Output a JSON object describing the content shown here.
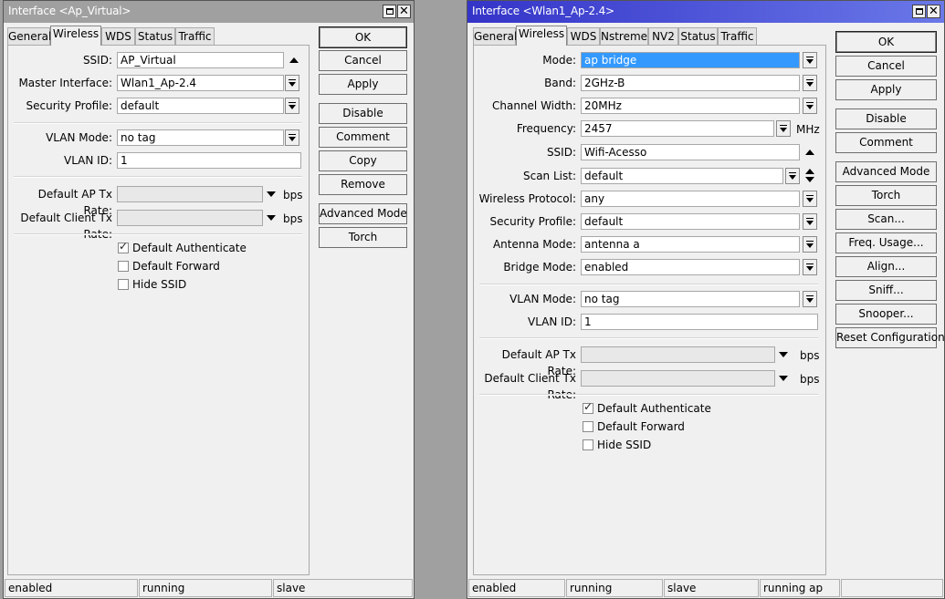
{
  "left": {
    "title": "Interface <Ap_Virtual>",
    "titlebar_color": "#a0a0a0",
    "tabs": [
      "General",
      "Wireless",
      "WDS",
      "Status",
      "Traffic"
    ],
    "active_tab": "Wireless",
    "ssid": {
      "label": "SSID:",
      "value": "AP_Virtual"
    },
    "master_interface": {
      "label": "Master Interface:",
      "value": "Wlan1_Ap-2.4"
    },
    "security_profile": {
      "label": "Security Profile:",
      "value": "default"
    },
    "vlan_mode": {
      "label": "VLAN Mode:",
      "value": "no tag"
    },
    "vlan_id": {
      "label": "VLAN ID:",
      "value": "1"
    },
    "default_ap_tx_rate": {
      "label": "Default AP Tx Rate:",
      "value": "",
      "unit": "bps"
    },
    "default_client_tx_rate": {
      "label": "Default Client Tx Rate:",
      "value": "",
      "unit": "bps"
    },
    "checkboxes": [
      {
        "label": "Default Authenticate",
        "checked": true
      },
      {
        "label": "Default Forward",
        "checked": false
      },
      {
        "label": "Hide SSID",
        "checked": false
      }
    ],
    "buttons": [
      "OK",
      "Cancel",
      "Apply",
      "Disable",
      "Comment",
      "Copy",
      "Remove",
      "Advanced Mode",
      "Torch"
    ],
    "status": [
      "enabled",
      "running",
      "slave"
    ]
  },
  "right": {
    "title": "Interface <Wlan1_Ap-2.4>",
    "titlebar_color": "#3c46d8",
    "tabs": [
      "General",
      "Wireless",
      "WDS",
      "Nstreme",
      "NV2",
      "Status",
      "Traffic"
    ],
    "active_tab": "Wireless",
    "mode": {
      "label": "Mode:",
      "value": "ap bridge"
    },
    "band": {
      "label": "Band:",
      "value": "2GHz-B"
    },
    "channel_width": {
      "label": "Channel Width:",
      "value": "20MHz"
    },
    "frequency": {
      "label": "Frequency:",
      "value": "2457",
      "unit": "MHz"
    },
    "ssid": {
      "label": "SSID:",
      "value": "Wifi-Acesso"
    },
    "scan_list": {
      "label": "Scan List:",
      "value": "default"
    },
    "wireless_protocol": {
      "label": "Wireless Protocol:",
      "value": "any"
    },
    "security_profile": {
      "label": "Security Profile:",
      "value": "default"
    },
    "antenna_mode": {
      "label": "Antenna Mode:",
      "value": "antenna a"
    },
    "bridge_mode": {
      "label": "Bridge Mode:",
      "value": "enabled"
    },
    "vlan_mode": {
      "label": "VLAN Mode:",
      "value": "no tag"
    },
    "vlan_id": {
      "label": "VLAN ID:",
      "value": "1"
    },
    "default_ap_tx_rate": {
      "label": "Default AP Tx Rate:",
      "value": "",
      "unit": "bps"
    },
    "default_client_tx_rate": {
      "label": "Default Client Tx Rate:",
      "value": "",
      "unit": "bps"
    },
    "checkboxes": [
      {
        "label": "Default Authenticate",
        "checked": true
      },
      {
        "label": "Default Forward",
        "checked": false
      },
      {
        "label": "Hide SSID",
        "checked": false
      }
    ],
    "buttons": [
      "OK",
      "Cancel",
      "Apply",
      "Disable",
      "Comment",
      "Advanced Mode",
      "Torch",
      "Scan...",
      "Freq. Usage...",
      "Align...",
      "Sniff...",
      "Snooper...",
      "Reset Configuration"
    ],
    "status": [
      "enabled",
      "running",
      "slave",
      "running ap",
      ""
    ]
  }
}
